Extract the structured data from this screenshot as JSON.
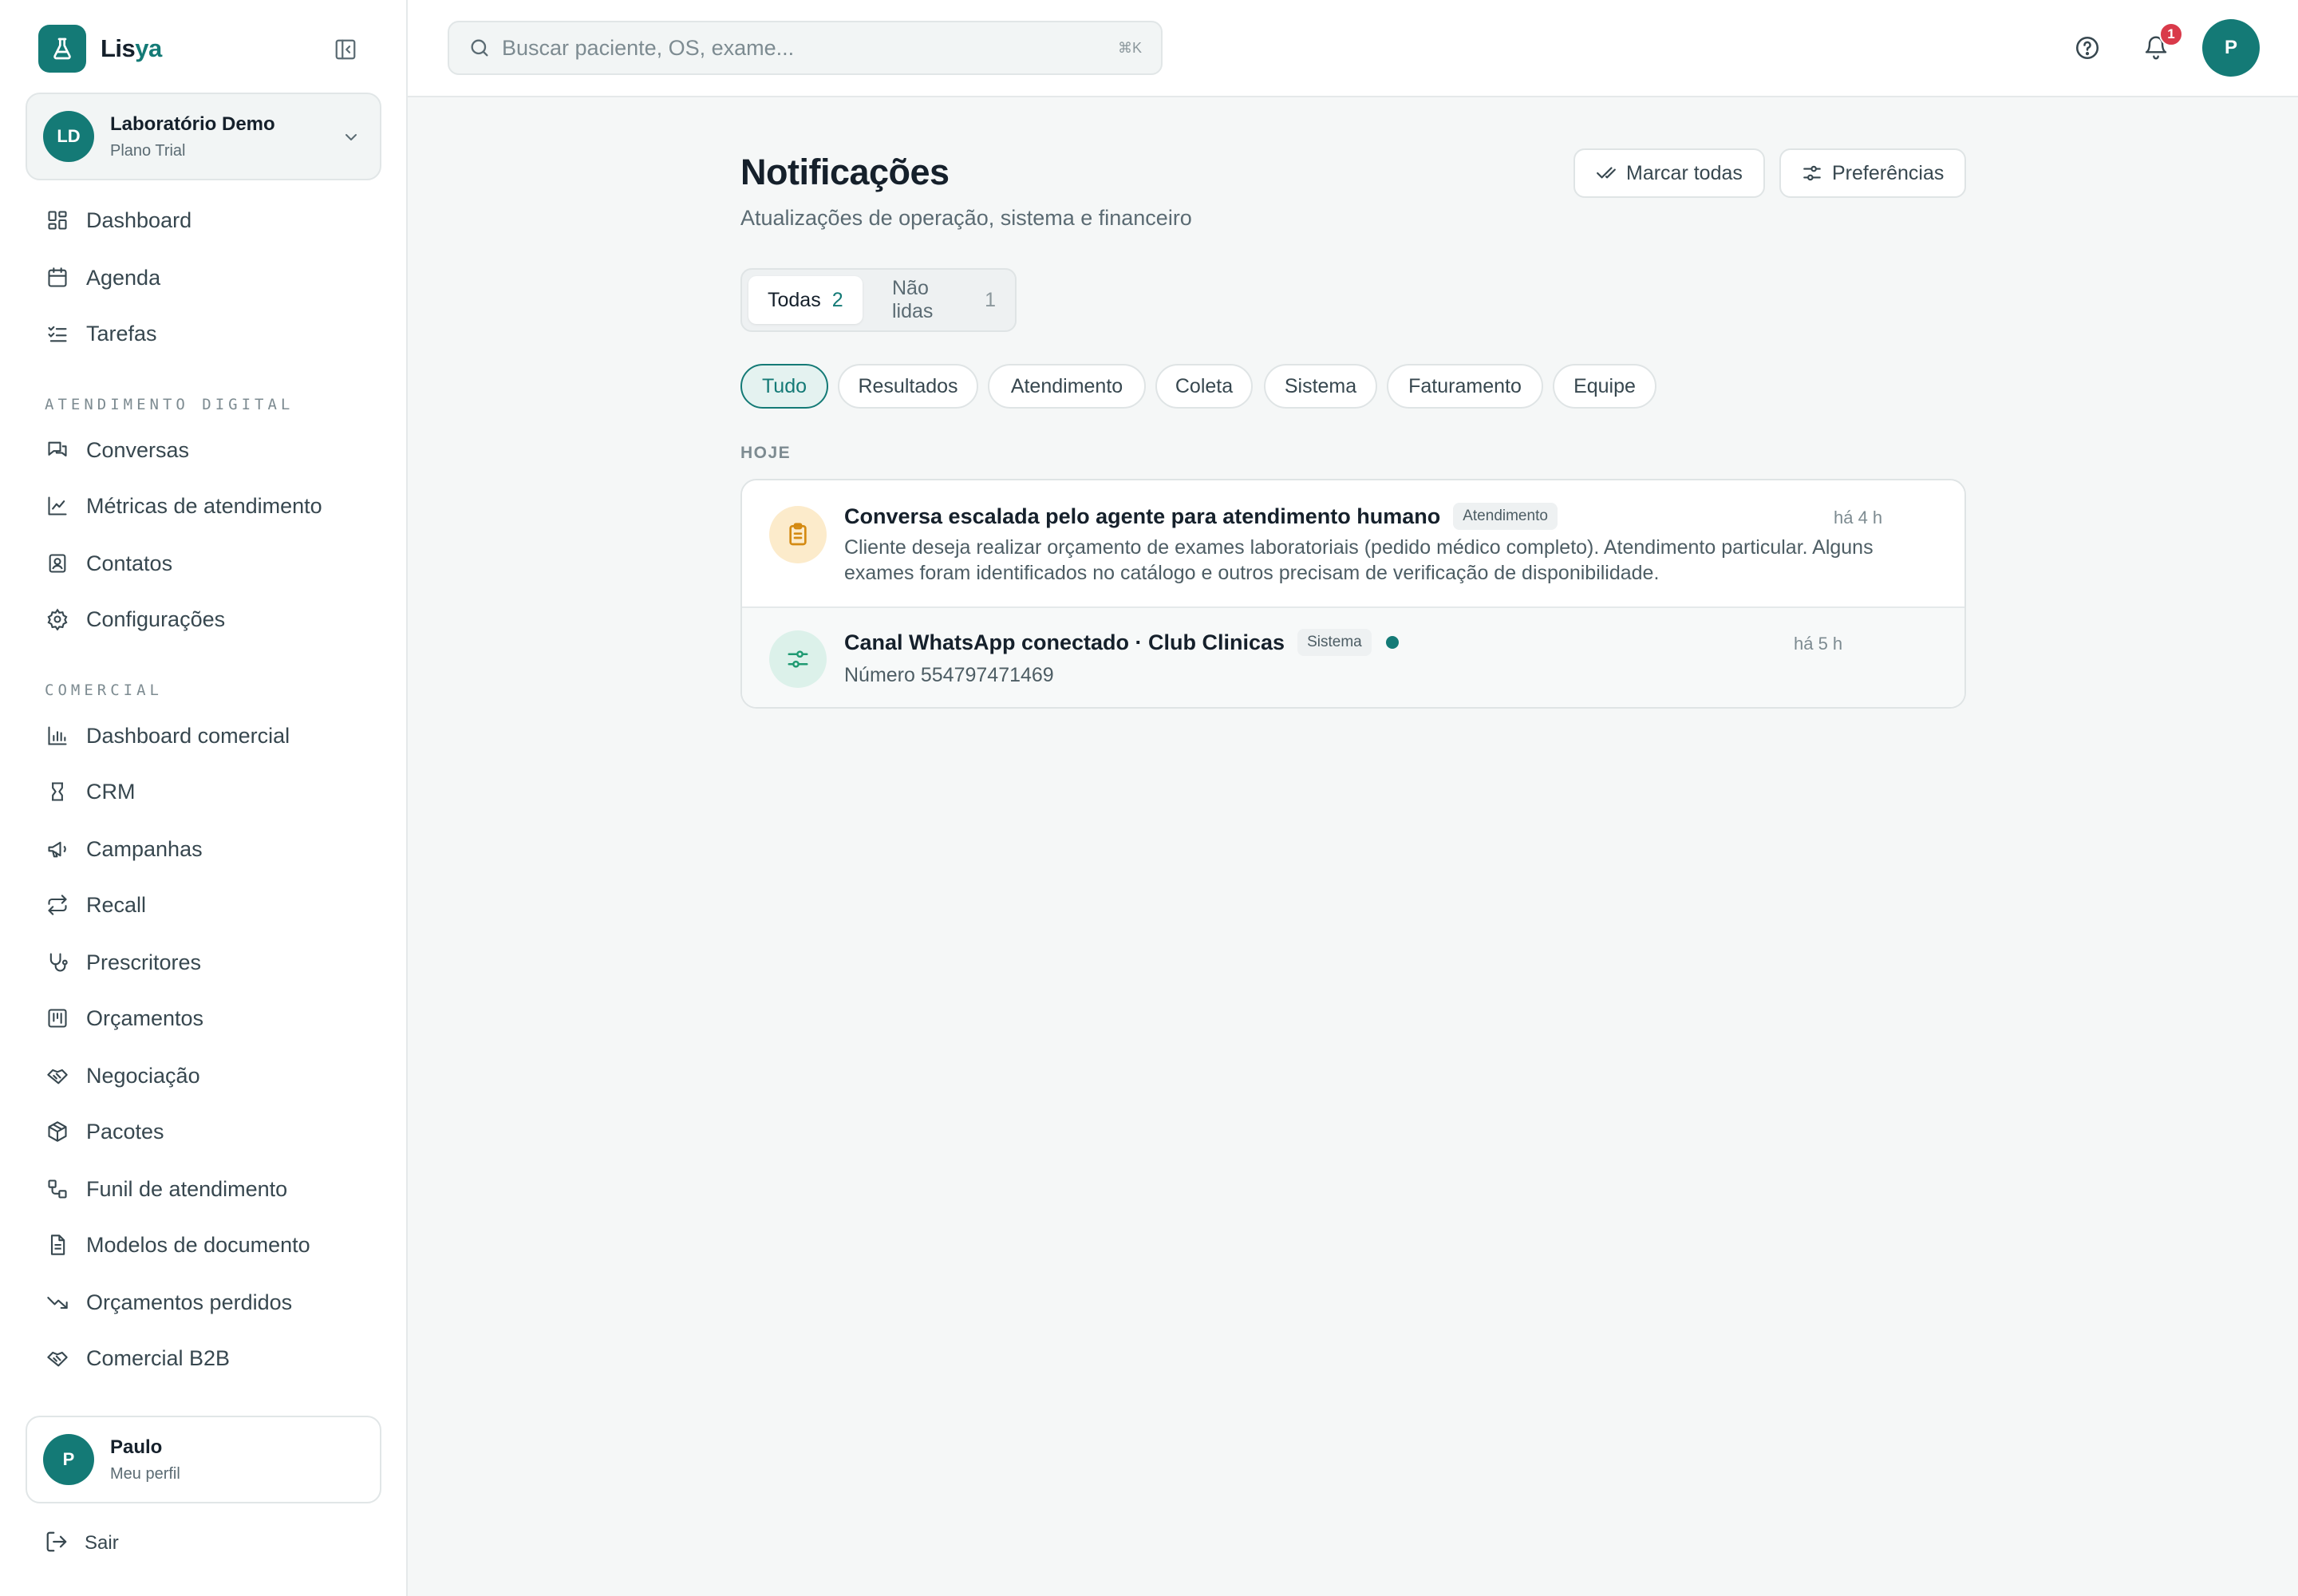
{
  "brand": {
    "name_main": "Lis",
    "name_accent": "ya"
  },
  "org": {
    "initials": "LD",
    "name": "Laboratório Demo",
    "plan": "Plano Trial"
  },
  "nav": {
    "primary": [
      {
        "label": "Dashboard",
        "icon": "dashboard-icon"
      },
      {
        "label": "Agenda",
        "icon": "calendar-icon"
      },
      {
        "label": "Tarefas",
        "icon": "tasks-icon"
      }
    ],
    "section_digital": "ATENDIMENTO DIGITAL",
    "digital": [
      {
        "label": "Conversas",
        "icon": "chat-icon"
      },
      {
        "label": "Métricas de atendimento",
        "icon": "line-chart-icon"
      },
      {
        "label": "Contatos",
        "icon": "contacts-icon"
      },
      {
        "label": "Configurações",
        "icon": "gear-icon"
      }
    ],
    "section_comercial": "COMERCIAL",
    "comercial": [
      {
        "label": "Dashboard comercial",
        "icon": "bar-chart-icon"
      },
      {
        "label": "CRM",
        "icon": "crm-icon"
      },
      {
        "label": "Campanhas",
        "icon": "megaphone-icon"
      },
      {
        "label": "Recall",
        "icon": "repeat-icon"
      },
      {
        "label": "Prescritores",
        "icon": "stethoscope-icon"
      },
      {
        "label": "Orçamentos",
        "icon": "quote-icon"
      },
      {
        "label": "Negociação",
        "icon": "handshake-icon"
      },
      {
        "label": "Pacotes",
        "icon": "package-icon"
      },
      {
        "label": "Funil de atendimento",
        "icon": "funnel-icon"
      },
      {
        "label": "Modelos de documento",
        "icon": "document-icon"
      },
      {
        "label": "Orçamentos perdidos",
        "icon": "trending-down-icon"
      },
      {
        "label": "Comercial B2B",
        "icon": "handshake-icon"
      }
    ]
  },
  "profile": {
    "initial": "P",
    "name": "Paulo",
    "sub": "Meu perfil",
    "logout": "Sair"
  },
  "topbar": {
    "search_placeholder": "Buscar paciente, OS, exame...",
    "shortcut": "⌘K",
    "notification_count": "1",
    "avatar_initial": "P"
  },
  "page": {
    "title": "Notificações",
    "subtitle": "Atualizações de operação, sistema e financeiro",
    "mark_all": "Marcar todas",
    "preferences": "Preferências"
  },
  "tabs": [
    {
      "label": "Todas",
      "count": "2",
      "active": true
    },
    {
      "label": "Não lidas",
      "count": "1",
      "active": false
    }
  ],
  "filters": [
    "Tudo",
    "Resultados",
    "Atendimento",
    "Coleta",
    "Sistema",
    "Faturamento",
    "Equipe"
  ],
  "active_filter": "Tudo",
  "group_label": "HOJE",
  "notifications": [
    {
      "icon": "clipboard-icon",
      "title": "Conversa escalada pelo agente para atendimento humano",
      "tag": "Atendimento",
      "time": "há 4 h",
      "body": "Cliente deseja realizar orçamento de exames laboratoriais (pedido médico completo). Atendimento particular. Alguns exames foram identificados no catálogo e outros precisam de verificação de disponibilidade.",
      "unread": false
    },
    {
      "icon": "settings-sliders-icon",
      "title": "Canal WhatsApp conectado · Club Clinicas",
      "tag": "Sistema",
      "time": "há 5 h",
      "body": "Número 554797471469",
      "unread": true
    }
  ],
  "colors": {
    "accent": "#147a76",
    "badge": "#d93a4a",
    "background": "#f5f7f7"
  }
}
